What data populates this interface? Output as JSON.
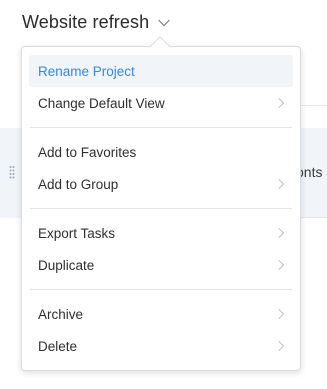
{
  "header": {
    "project_title": "Website refresh"
  },
  "background": {
    "row_text_fragment": "onts"
  },
  "menu": {
    "groups": [
      {
        "items": [
          {
            "label": "Rename Project",
            "has_submenu": false,
            "highlighted": true
          },
          {
            "label": "Change Default View",
            "has_submenu": true,
            "highlighted": false
          }
        ]
      },
      {
        "items": [
          {
            "label": "Add to Favorites",
            "has_submenu": false,
            "highlighted": false
          },
          {
            "label": "Add to Group",
            "has_submenu": true,
            "highlighted": false
          }
        ]
      },
      {
        "items": [
          {
            "label": "Export Tasks",
            "has_submenu": true,
            "highlighted": false
          },
          {
            "label": "Duplicate",
            "has_submenu": true,
            "highlighted": false
          }
        ]
      },
      {
        "items": [
          {
            "label": "Archive",
            "has_submenu": true,
            "highlighted": false
          },
          {
            "label": "Delete",
            "has_submenu": true,
            "highlighted": false
          }
        ]
      }
    ]
  },
  "colors": {
    "highlight_text": "#3a87d6",
    "highlight_bg": "#f1f4f9",
    "chevron": "#c4c6cc",
    "text": "#2f2f2f"
  },
  "icons": {
    "title_dropdown": "chevron-down-icon",
    "submenu": "chevron-right-icon",
    "drag_handle": "drag-handle-icon"
  }
}
